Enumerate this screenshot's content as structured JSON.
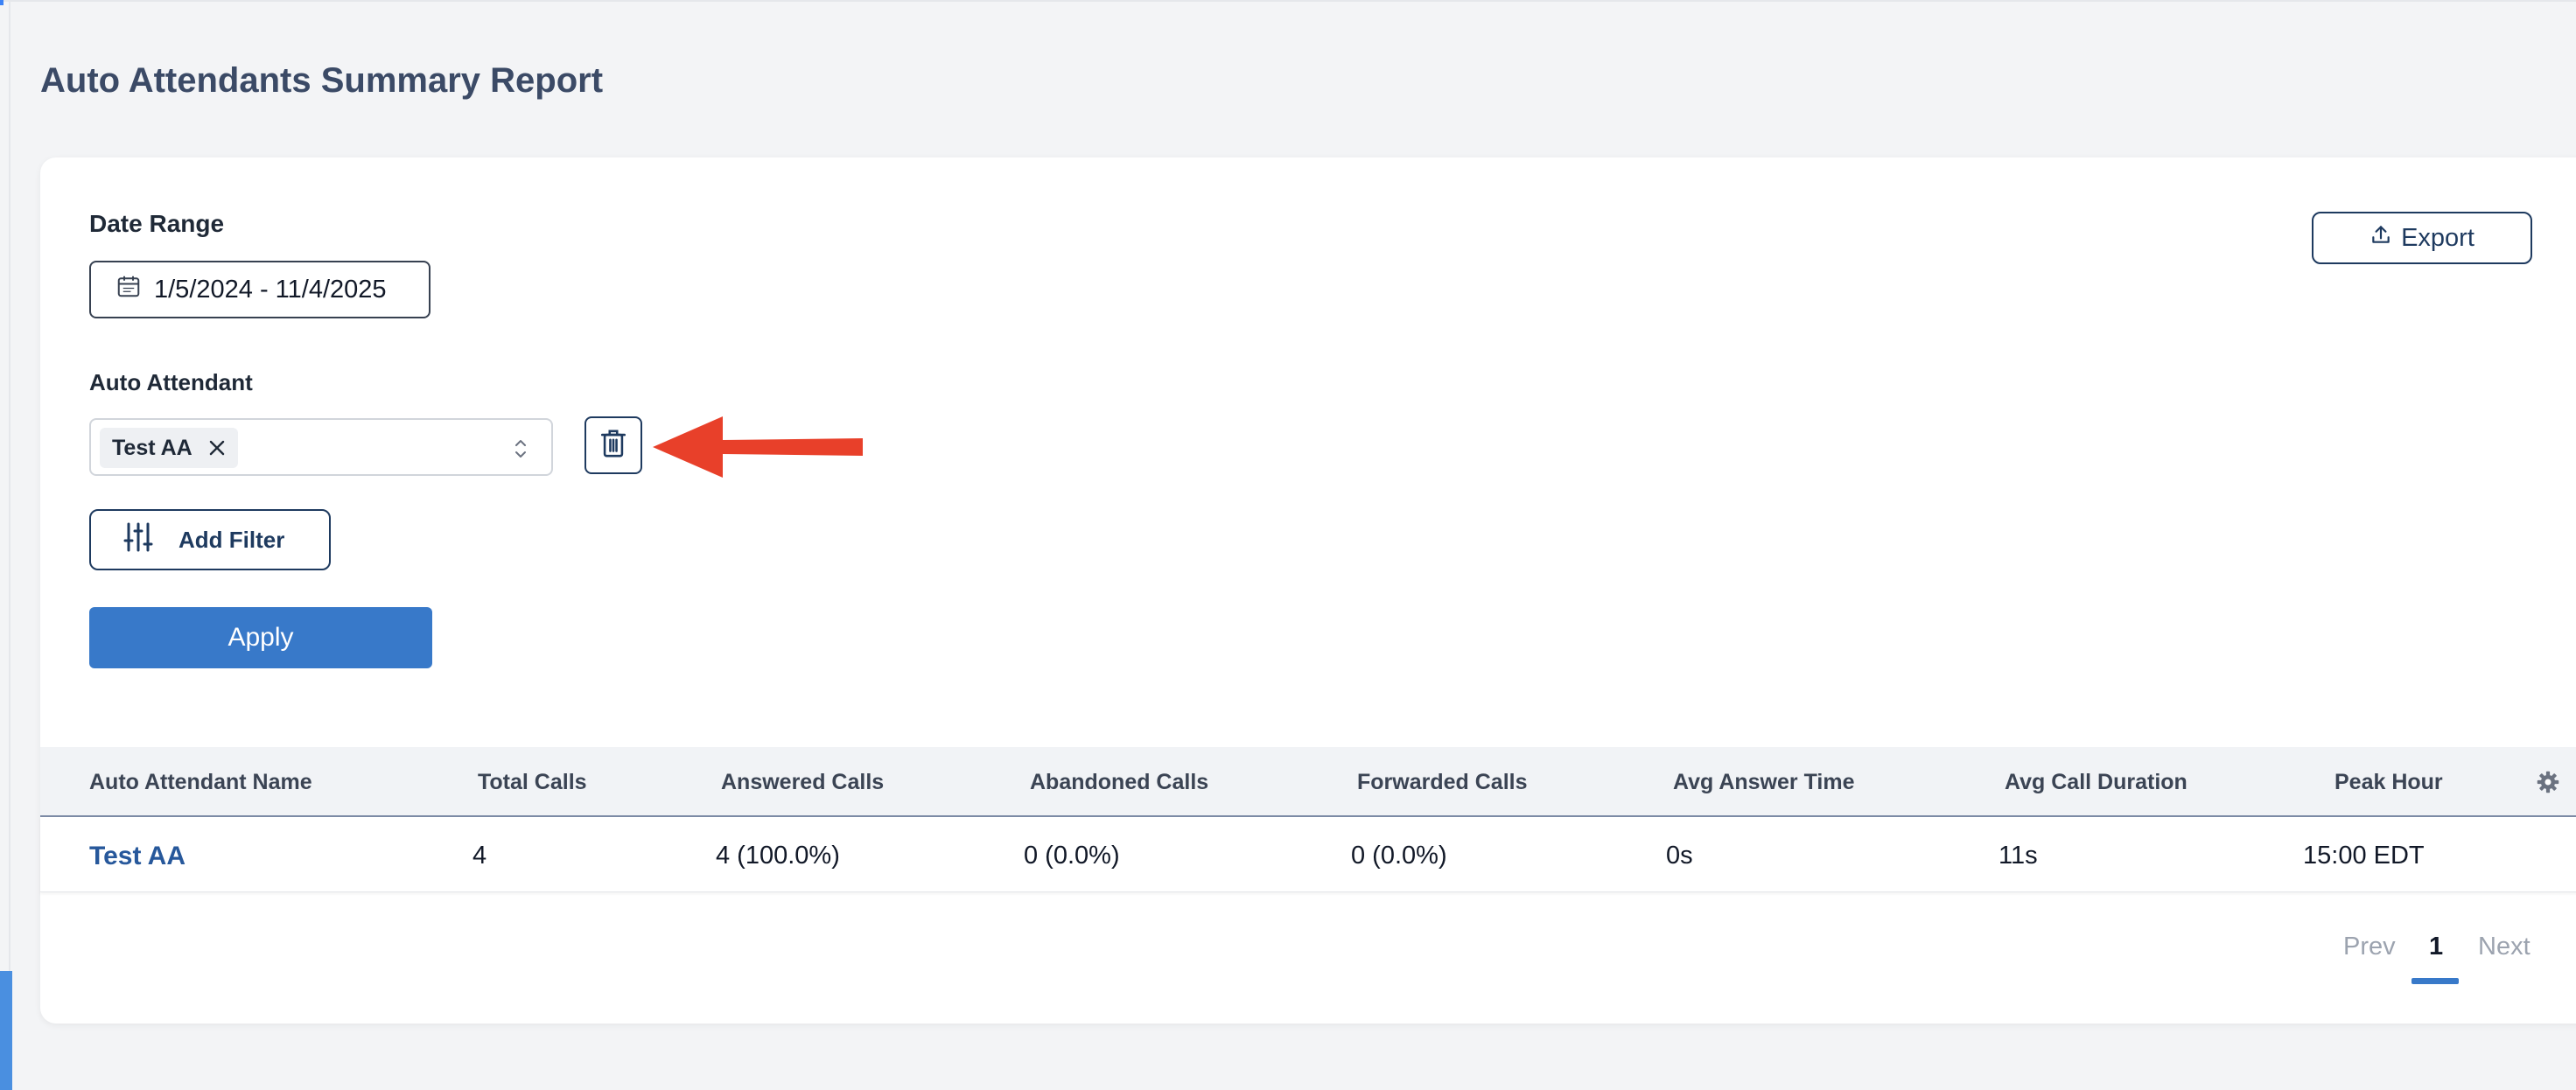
{
  "page": {
    "title": "Auto Attendants Summary Report"
  },
  "filters": {
    "date_range_label": "Date Range",
    "date_range_value": "1/5/2024 - 11/4/2025",
    "auto_attendant_label": "Auto Attendant",
    "selected_chip": "Test AA",
    "add_filter_label": "Add Filter",
    "apply_label": "Apply"
  },
  "toolbar": {
    "export_label": "Export"
  },
  "table": {
    "columns": [
      "Auto Attendant Name",
      "Total Calls",
      "Answered Calls",
      "Abandoned Calls",
      "Forwarded Calls",
      "Avg Answer Time",
      "Avg Call Duration",
      "Peak Hour"
    ],
    "rows": [
      [
        "Test AA",
        "4",
        "4 (100.0%)",
        "0 (0.0%)",
        "0 (0.0%)",
        "0s",
        "11s",
        "15:00 EDT"
      ]
    ]
  },
  "pagination": {
    "prev_label": "Prev",
    "current_page": "1",
    "next_label": "Next"
  },
  "colors": {
    "accent": "#3879c9",
    "annotation_arrow": "#e8402a",
    "link": "#27589b"
  },
  "icons": {
    "date": "calendar-icon",
    "export": "upload-icon",
    "chip_remove": "close-icon",
    "select": "chevron-updown-icon",
    "delete": "trash-icon",
    "filter": "sliders-icon",
    "settings": "gear-icon",
    "annotation": "arrow-left-icon"
  }
}
